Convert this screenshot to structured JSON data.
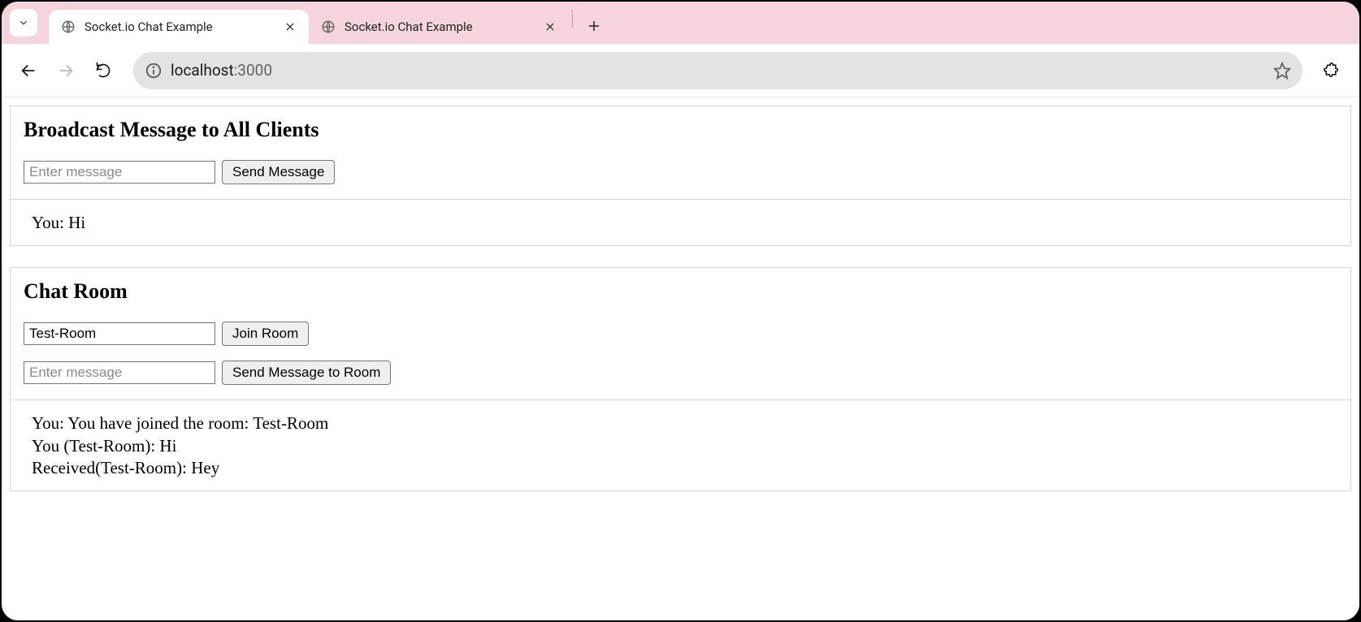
{
  "browser": {
    "tabs": [
      {
        "title": "Socket.io Chat Example",
        "active": true
      },
      {
        "title": "Socket.io Chat Example",
        "active": false
      }
    ],
    "url_host": "localhost",
    "url_rest": ":3000"
  },
  "broadcast": {
    "heading": "Broadcast Message to All Clients",
    "input_placeholder": "Enter message",
    "input_value": "",
    "send_label": "Send Message",
    "log": [
      "You: Hi"
    ]
  },
  "room": {
    "heading": "Chat Room",
    "room_input_value": "Test-Room",
    "room_input_placeholder": "",
    "join_label": "Join Room",
    "msg_input_placeholder": "Enter message",
    "msg_input_value": "",
    "send_label": "Send Message to Room",
    "log": [
      "You: You have joined the room: Test-Room",
      "You (Test-Room): Hi",
      "Received(Test-Room): Hey"
    ]
  }
}
